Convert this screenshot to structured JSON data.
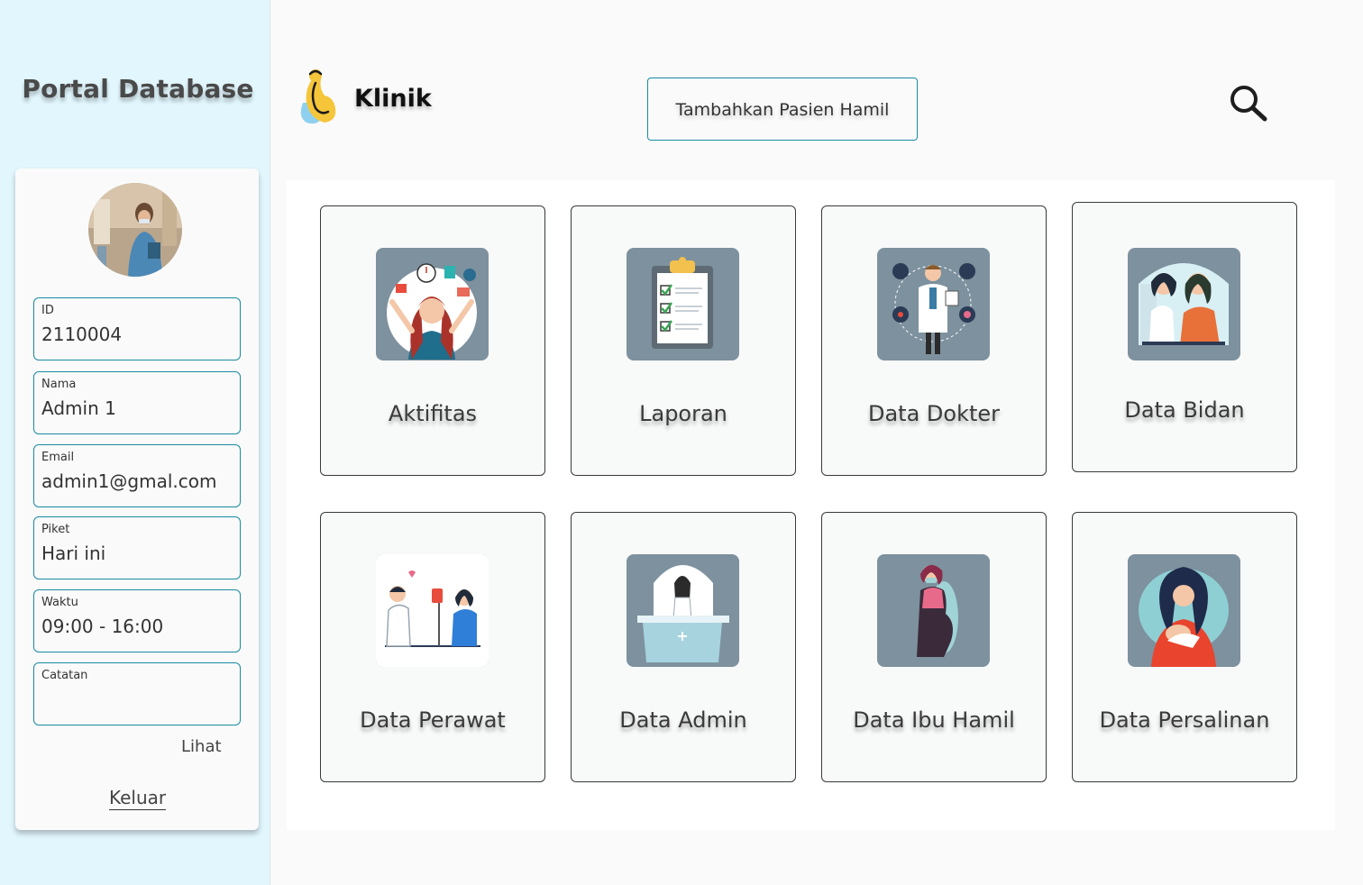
{
  "sidebar": {
    "title": "Portal Database",
    "profile": {
      "fields": [
        {
          "label": "ID",
          "value": "2110004"
        },
        {
          "label": "Nama",
          "value": "Admin 1"
        },
        {
          "label": "Email",
          "value": "admin1@gmal.com"
        },
        {
          "label": "Piket",
          "value": "Hari ini"
        },
        {
          "label": "Waktu",
          "value": "09:00 - 16:00"
        },
        {
          "label": "Catatan",
          "value": ""
        }
      ],
      "view_link": "Lihat",
      "logout_link": "Keluar"
    }
  },
  "header": {
    "brand": "Klinik",
    "add_button": "Tambahkan Pasien Hamil",
    "search_icon": "search-icon"
  },
  "menu": {
    "tiles": [
      {
        "label": "Aktifitas",
        "icon": "activity-illustration"
      },
      {
        "label": "Laporan",
        "icon": "clipboard-report-illustration"
      },
      {
        "label": "Data Dokter",
        "icon": "doctor-illustration"
      },
      {
        "label": "Data Bidan",
        "icon": "midwife-illustration"
      },
      {
        "label": "Data Perawat",
        "icon": "nurse-illustration"
      },
      {
        "label": "Data Admin",
        "icon": "admin-desk-illustration"
      },
      {
        "label": "Data Ibu Hamil",
        "icon": "pregnant-woman-illustration"
      },
      {
        "label": "Data Persalinan",
        "icon": "mother-baby-illustration"
      }
    ]
  },
  "colors": {
    "sidebar_bg": "#e1f6fd",
    "accent_border": "#1a8ba1",
    "tile_image_bg": "#7d919e"
  }
}
